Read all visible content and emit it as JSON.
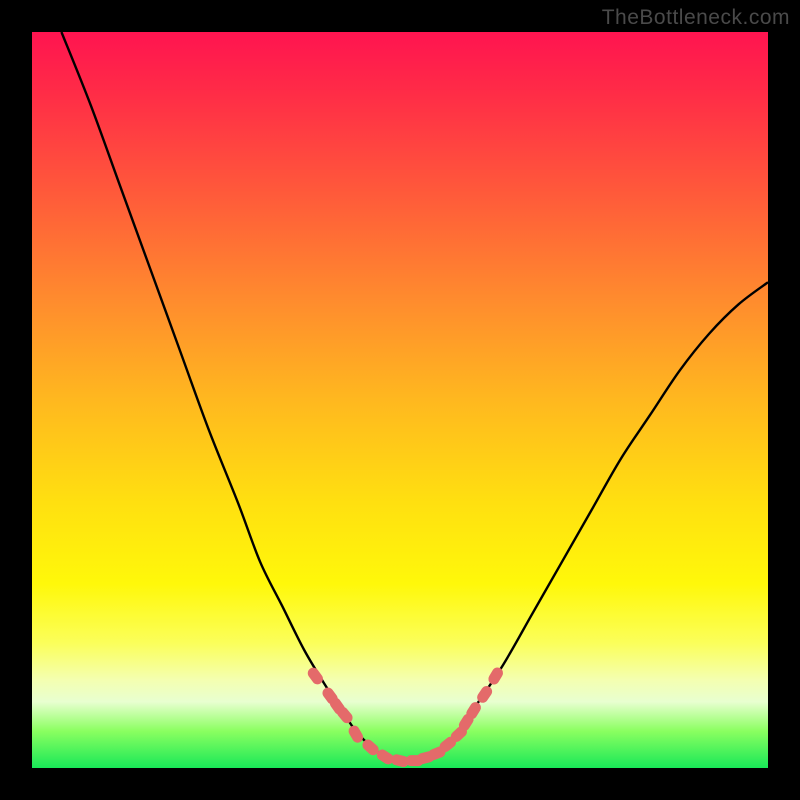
{
  "watermark": {
    "text": "TheBottleneck.com"
  },
  "colors": {
    "frame": "#000000",
    "curve": "#000000",
    "marker": "#e46a6a",
    "gradient_stops": [
      "#ff1450",
      "#ff2b47",
      "#ff5a3a",
      "#ff8a2e",
      "#ffb81f",
      "#ffe010",
      "#fff80a",
      "#fbff5a",
      "#f4ffb0",
      "#e8ffd0",
      "#8aff60",
      "#18e858"
    ]
  },
  "chart_data": {
    "type": "line",
    "title": "",
    "xlabel": "",
    "ylabel": "",
    "xlim": [
      0,
      100
    ],
    "ylim": [
      0,
      100
    ],
    "grid": false,
    "legend": false,
    "series": [
      {
        "name": "bottleneck-curve",
        "x": [
          4,
          8,
          12,
          16,
          20,
          24,
          28,
          31,
          34,
          37,
          40,
          42,
          44,
          46,
          48,
          50,
          52,
          54,
          56,
          58,
          60,
          64,
          68,
          72,
          76,
          80,
          84,
          88,
          92,
          96,
          100
        ],
        "y": [
          100,
          90,
          79,
          68,
          57,
          46,
          36,
          28,
          22,
          16,
          11,
          8,
          5,
          3,
          1.5,
          1,
          1,
          1.5,
          3,
          5,
          8,
          14,
          21,
          28,
          35,
          42,
          48,
          54,
          59,
          63,
          66
        ]
      }
    ],
    "markers": {
      "name": "highlight-points",
      "x": [
        38.5,
        40.5,
        41.5,
        42.5,
        44,
        46,
        48,
        50,
        52,
        53.5,
        55,
        56.5,
        58,
        59,
        60,
        61.5,
        63
      ],
      "y": [
        12.5,
        9.8,
        8.4,
        7.2,
        4.6,
        2.8,
        1.5,
        1,
        1,
        1.4,
        2,
        3.2,
        4.6,
        6.2,
        7.8,
        10,
        12.5
      ]
    }
  }
}
